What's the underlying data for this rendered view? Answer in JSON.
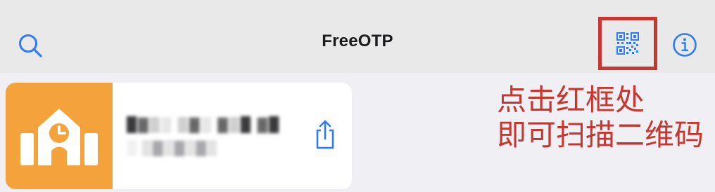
{
  "navbar": {
    "title": "FreeOTP",
    "search_icon": "search-icon",
    "qr_icon": "qr-code-icon",
    "info_icon": "info-icon",
    "highlight_color": "#c8372f",
    "accent_color": "#2f7bf6"
  },
  "token": {
    "logo_icon": "building-clock-icon",
    "logo_color": "#f3a23c",
    "issuer": "█▓▒░ ▒▓░ ▓▒█ ▓█",
    "account": "░ ▒▓▒▓▒▓▒",
    "share_icon": "share-icon"
  },
  "annotation": {
    "line1": "点击红框处",
    "line2": "即可扫描二维码"
  }
}
